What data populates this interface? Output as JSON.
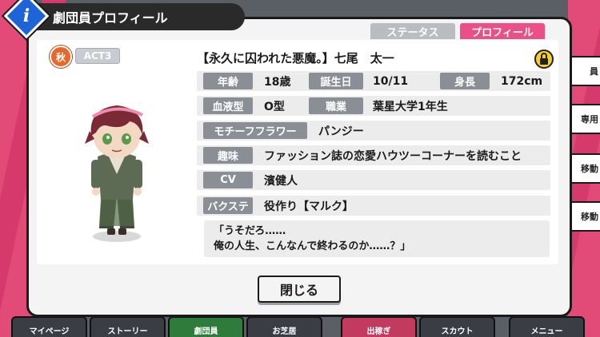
{
  "header": {
    "title": "劇団員プロフィール",
    "info_glyph": "i"
  },
  "tabs": [
    {
      "label": "ステータス",
      "active": false
    },
    {
      "label": "プロフィール",
      "active": true
    }
  ],
  "badges": {
    "season": "秋",
    "act": "ACT3"
  },
  "character": {
    "name": "【永久に囚われた悪魔。】七尾　太一"
  },
  "profile": {
    "age_label": "年齢",
    "age": "18歳",
    "birthday_label": "誕生日",
    "birthday": "10/11",
    "height_label": "身長",
    "height": "172cm",
    "blood_label": "血液型",
    "blood": "O型",
    "job_label": "職業",
    "job": "葉星大学1年生",
    "flower_label": "モチーフフラワー",
    "flower": "パンジー",
    "hobby_label": "趣味",
    "hobby": "ファッション誌の恋愛ハウツーコーナーを読むこと",
    "cv_label": "CV",
    "cv": "濱健人",
    "backstage_label": "バクステ",
    "backstage": "役作り【マルク】"
  },
  "quote": {
    "line1": "「うそだろ……",
    "line2": "俺の人生、こんなんで終わるのか……？」"
  },
  "close_label": "閉じる",
  "side_tabs": [
    "員",
    "専用",
    "移動",
    "移動"
  ],
  "bottom_nav": [
    "マイページ",
    "ストーリー",
    "劇団員",
    "お芝居",
    "出稼ぎ",
    "スカウト",
    "メニュー"
  ],
  "colors": {
    "accent_pink": "#ec4f86",
    "tab_inactive": "#b9bcc1",
    "label_gray": "#8a8f96",
    "info_blue": "#1f63d8",
    "season_orange": "#e8672a",
    "lock_yellow": "#f6cf2a"
  },
  "icons": {
    "lock": "lock-icon",
    "info": "info-icon"
  }
}
